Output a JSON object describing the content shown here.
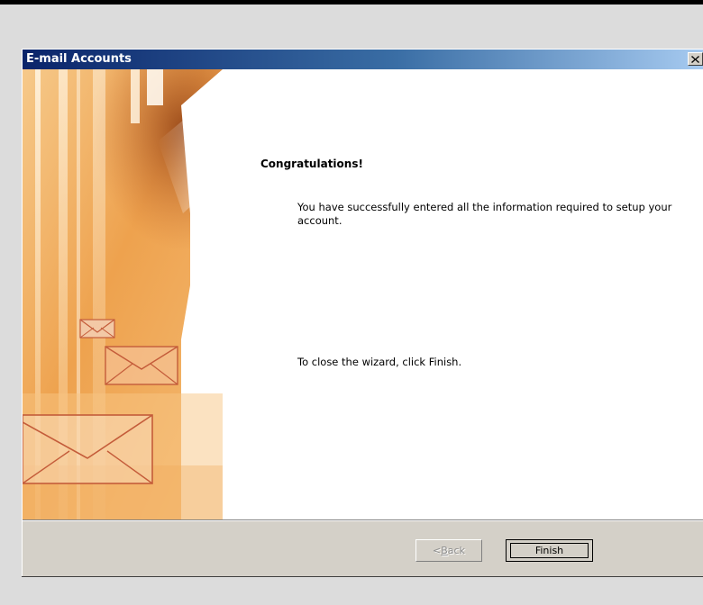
{
  "window": {
    "title": "E-mail Accounts",
    "close_glyph": "✕"
  },
  "content": {
    "heading": "Congratulations!",
    "message": "You have successfully entered all the information required to setup your account.",
    "instruction": "To close the wizard, click Finish."
  },
  "buttons": {
    "back_prefix": "< ",
    "back_accel": "B",
    "back_rest": "ack",
    "finish_label": "Finish"
  },
  "colors": {
    "title_bar_start": "#0a246a",
    "title_bar_end": "#a6caf0",
    "dialog_face": "#d4d0c8",
    "banner_orange": "#e8923a"
  },
  "icons": {
    "close": "close-icon",
    "banner_envelopes": "envelope-icon"
  }
}
